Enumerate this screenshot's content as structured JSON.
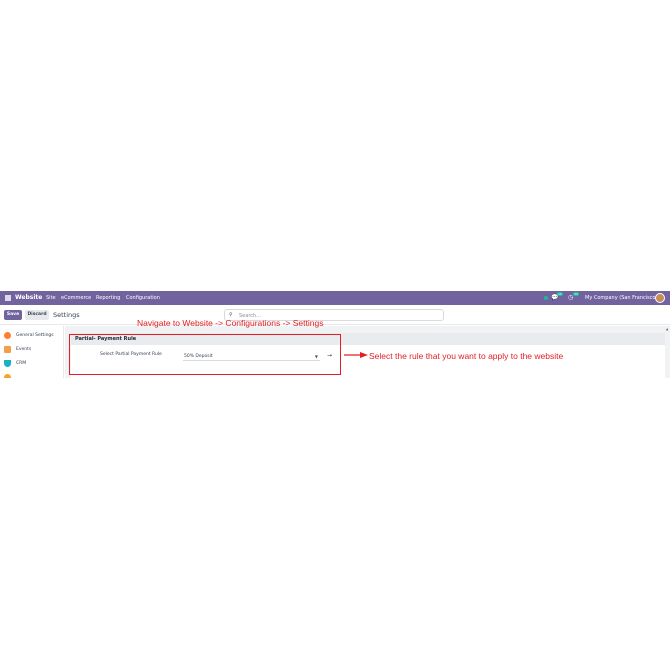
{
  "navbar": {
    "app_name": "Website",
    "menu": [
      "Site",
      "eCommerce",
      "Reporting",
      "Configuration"
    ],
    "chat_count": "10",
    "activity_count": "34",
    "company": "My Company (San Francisco)",
    "icons": [
      "apps-grid-icon",
      "status-dot-icon",
      "chat-icon",
      "clock-icon",
      "avatar"
    ]
  },
  "control": {
    "save_label": "Save",
    "discard_label": "Discard",
    "breadcrumb": "Settings",
    "search_placeholder": "Search..."
  },
  "sidebar": {
    "items": [
      {
        "label": "General Settings",
        "icon": "settings-icon",
        "color": "#ff7f2a"
      },
      {
        "label": "Events",
        "icon": "events-icon",
        "color": "#f0a04b"
      },
      {
        "label": "CRM",
        "icon": "crm-icon",
        "color": "#1ab0c8"
      },
      {
        "label": "",
        "icon": "sales-icon",
        "color": "#f5a623"
      }
    ]
  },
  "settings": {
    "section_title": "Partial- Payment Rule",
    "field_label": "Select Partial Payment Rule",
    "field_value": "50% Deposit"
  },
  "annotations": {
    "top": "Navigate to Website -> Configurations -> Settings",
    "right": "Select the rule that you want to apply to the website",
    "color": "#e31e24"
  },
  "colors": {
    "brand": "#71639e",
    "page_bg": "#f1f2f4"
  }
}
